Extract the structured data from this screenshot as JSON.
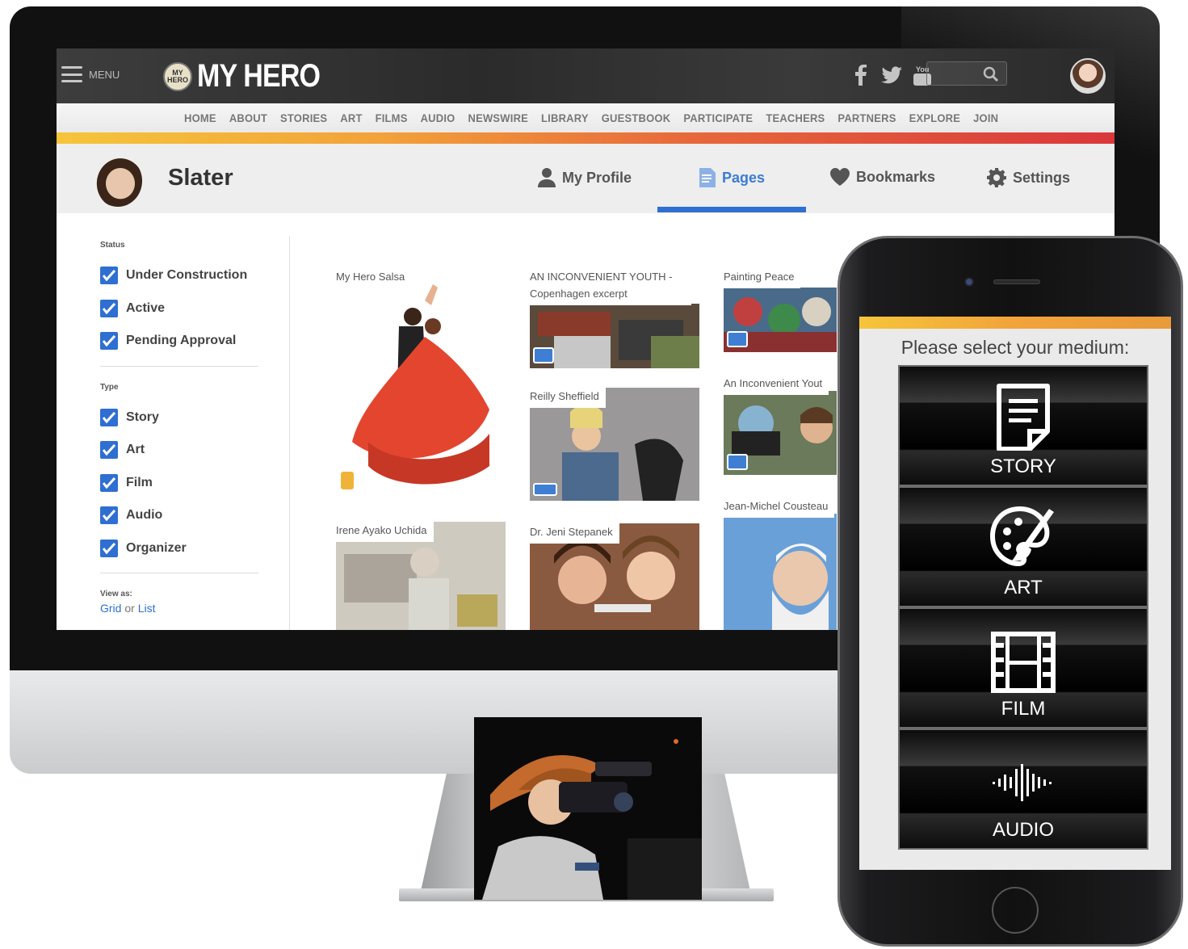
{
  "topbar": {
    "menu_label": "MENU",
    "logo_badge": "MY HERO",
    "logo_text": "MY HERO",
    "social_icons": [
      "facebook-icon",
      "twitter-icon",
      "youtube-icon"
    ],
    "search_placeholder": ""
  },
  "nav": {
    "items": [
      "HOME",
      "ABOUT",
      "STORIES",
      "ART",
      "FILMS",
      "AUDIO",
      "NEWSWIRE",
      "LIBRARY",
      "GUESTBOOK",
      "PARTICIPATE",
      "TEACHERS",
      "PARTNERS",
      "EXPLORE",
      "JOIN"
    ]
  },
  "profile": {
    "name": "Slater",
    "tabs": [
      {
        "label": "My Profile",
        "icon": "person-icon"
      },
      {
        "label": "Pages",
        "icon": "page-icon",
        "active": true
      },
      {
        "label": "Bookmarks",
        "icon": "heart-icon"
      },
      {
        "label": "Settings",
        "icon": "gear-icon"
      }
    ]
  },
  "sidebar": {
    "status_label": "Status",
    "status_items": [
      "Under Construction",
      "Active",
      "Pending Approval"
    ],
    "type_label": "Type",
    "type_items": [
      "Story",
      "Art",
      "Film",
      "Audio",
      "Organizer"
    ],
    "view_as_label": "View as:",
    "view_grid": "Grid",
    "view_or": " or ",
    "view_list": "List"
  },
  "cards": [
    {
      "title": "My Hero Salsa"
    },
    {
      "title": "AN INCONVENIENT YOUTH - Copenhagen excerpt"
    },
    {
      "title": "Painting Peace"
    },
    {
      "title": "Reilly Sheffield"
    },
    {
      "title": "An Inconvenient Yout"
    },
    {
      "title": "Irene Ayako Uchida"
    },
    {
      "title": "Dr. Jeni Stepanek"
    },
    {
      "title": "Jean-Michel Cousteau"
    }
  ],
  "phone": {
    "prompt": "Please select your medium:",
    "options": [
      {
        "label": "STORY",
        "icon": "document-icon"
      },
      {
        "label": "ART",
        "icon": "palette-icon"
      },
      {
        "label": "FILM",
        "icon": "film-strip-icon"
      },
      {
        "label": "AUDIO",
        "icon": "sound-wave-icon"
      }
    ]
  },
  "colors": {
    "accent_blue": "#2f6fd1",
    "strip_yellow": "#f5c53a",
    "strip_red": "#d9383b"
  }
}
